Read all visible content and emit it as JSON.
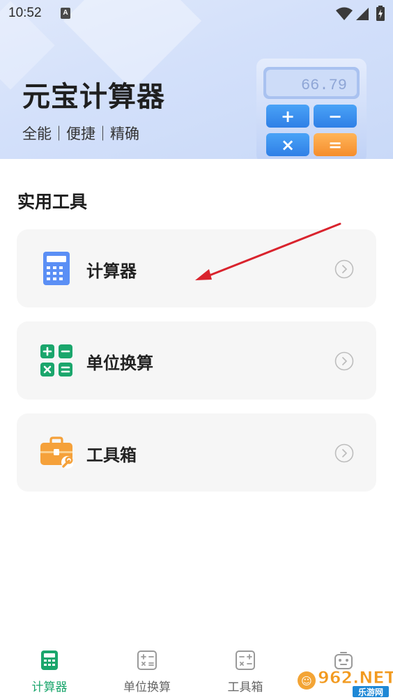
{
  "status_bar": {
    "time": "10:52",
    "notification_icon": "A",
    "icons": [
      "wifi-icon",
      "signal-icon",
      "battery-charging-icon"
    ]
  },
  "header": {
    "title": "元宝计算器",
    "slogan": "全能｜便捷｜精确",
    "illustration": {
      "display_value": "66.79",
      "keys": [
        "+",
        "−",
        "×",
        "="
      ]
    }
  },
  "section": {
    "title": "实用工具"
  },
  "tools": [
    {
      "label": "计算器",
      "icon": "calculator-icon"
    },
    {
      "label": "单位换算",
      "icon": "unit-convert-icon"
    },
    {
      "label": "工具箱",
      "icon": "toolbox-icon"
    }
  ],
  "bottom_nav": [
    {
      "label": "计算器",
      "icon": "calculator-icon",
      "active": true
    },
    {
      "label": "单位换算",
      "icon": "unit-convert-icon",
      "active": false
    },
    {
      "label": "工具箱",
      "icon": "toolbox-icon",
      "active": false
    },
    {
      "label": "",
      "icon": "robot-icon",
      "active": false
    }
  ],
  "watermark": {
    "text": "962.NET",
    "subtext": "乐游网"
  },
  "colors": {
    "accent_green": "#1aa66c",
    "calc_blue": "#5b8ff5",
    "orange": "#f5a13a",
    "card_bg": "#f6f6f6",
    "annotation_red": "#d9232d"
  }
}
